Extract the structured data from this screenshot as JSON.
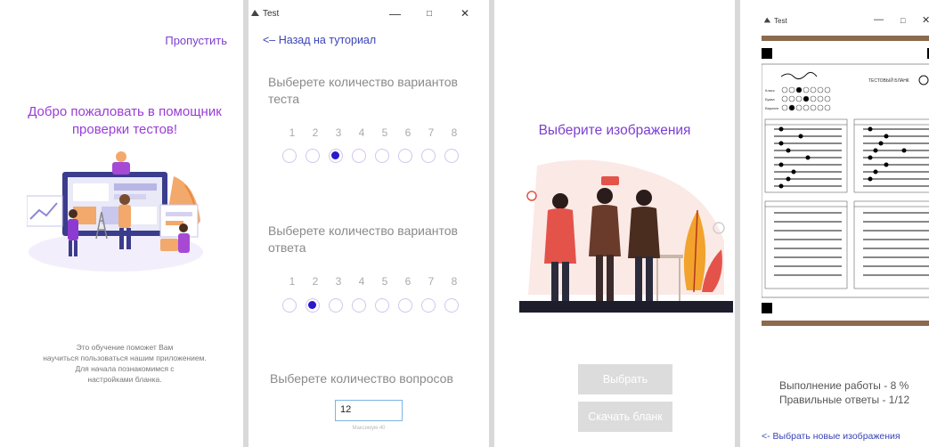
{
  "screen1": {
    "skip_label": "Пропустить",
    "welcome_line1": "Добро пожаловать в помощник",
    "welcome_line2": "проверки тестов!",
    "hint_line1": "Это обучение поможет Вам",
    "hint_line2": "научиться пользоваться нашим приложением.",
    "hint_line3": "Для начала познакомимся с",
    "hint_line4": "настройками бланка."
  },
  "screen2": {
    "window_title": "Test",
    "window_controls": [
      "—",
      "□",
      "✕"
    ],
    "back_label": "<– Назад на туториал",
    "variants_label": "Выберете количество вариантов теста",
    "answers_label": "Выберете количество вариантов ответа",
    "options": [
      "1",
      "2",
      "3",
      "4",
      "5",
      "6",
      "7",
      "8"
    ],
    "variants_selected": 3,
    "answers_selected": 2,
    "questions_label": "Выберете количество вопросов",
    "questions_value": "12",
    "max_note": "Максимум 40"
  },
  "screen3": {
    "title": "Выберите изображения",
    "select_button": "Выбрать",
    "download_button": "Скачать бланк"
  },
  "screen4": {
    "window_title": "Test",
    "window_controls": [
      "—",
      "□",
      "✕"
    ],
    "sheet_title": "ТЕСТОВЫЙ БЛАНК",
    "sheet_labels": [
      "Класс",
      "Буква",
      "Вариант"
    ],
    "progress_text": "Выполнение работы - 8 %",
    "correct_text": "Правильные ответы - 1/12",
    "new_images_link": "<- Выбрать новые изображения"
  },
  "colors": {
    "accent_purple": "#7b3fd0",
    "link_blue": "#3a44b8",
    "radio_selected": "#2a18c9",
    "button_disabled": "#dcdcdc"
  }
}
